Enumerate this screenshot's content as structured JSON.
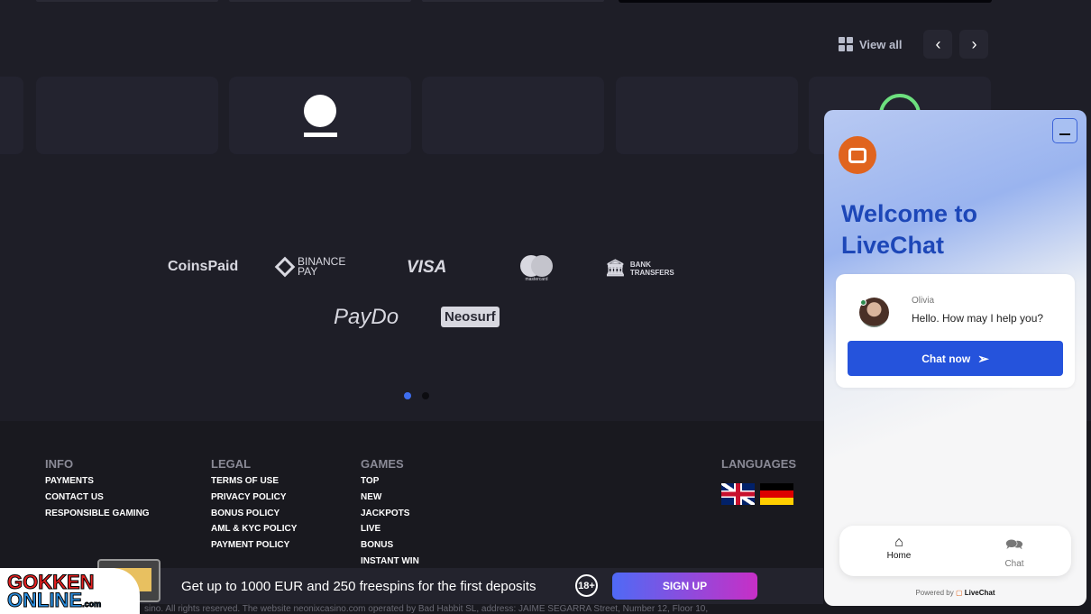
{
  "top_nav": {
    "view_all": "View all",
    "prev_icon": "chevron-left-icon",
    "next_icon": "chevron-right-icon"
  },
  "payments": {
    "coinspaid": "CoinsPaid",
    "binance_line1": "BINANCE",
    "binance_line2": "PAY",
    "visa": "VISA",
    "mastercard": "mastercard",
    "bank_line1": "BANK",
    "bank_line2": "TRANSFERS",
    "paydo": "PayDo",
    "neosurf": "Neosurf"
  },
  "footer": {
    "info": {
      "title": "INFO",
      "items": [
        "PAYMENTS",
        "CONTACT US",
        "RESPONSIBLE GAMING"
      ]
    },
    "legal": {
      "title": "LEGAL",
      "items": [
        "TERMS OF USE",
        "PRIVACY POLICY",
        "BONUS POLICY",
        "AML & KYC POLICY",
        "PAYMENT POLICY"
      ]
    },
    "games": {
      "title": "GAMES",
      "items": [
        "TOP",
        "NEW",
        "JACKPOTS",
        "LIVE",
        "BONUS",
        "INSTANT WIN"
      ]
    },
    "languages": {
      "title": "LANGUAGES"
    },
    "copyright": "sino. All rights reserved. The website neonixcasino.com operated by Bad Habbit SL, address: JAIME SEGARRA Street, Number 12, Floor 10,"
  },
  "banner": {
    "logo_line1": "GOKKEN",
    "logo_line2": "ONLINE",
    "logo_suffix": ".com",
    "promo": "Get up to 1000 EUR and 250 freespins for the first deposits",
    "age": "18+",
    "signup": "SIGN UP"
  },
  "chat": {
    "welcome_line1": "Welcome to",
    "welcome_line2": "LiveChat",
    "agent": "Olivia",
    "message": "Hello. How may I help you?",
    "chat_now": "Chat now",
    "tab_home": "Home",
    "tab_chat": "Chat",
    "powered_by": "Powered by",
    "brand": "LiveChat",
    "accent": "#2553dc"
  }
}
